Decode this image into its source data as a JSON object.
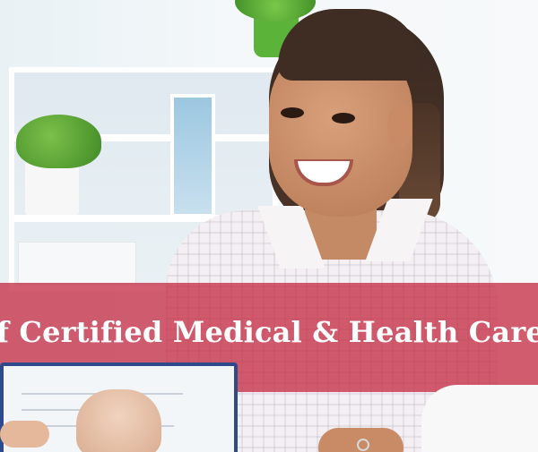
{
  "banner": {
    "text": "s of Certified Medical & Health Care Inte",
    "color": "#c52f46"
  }
}
